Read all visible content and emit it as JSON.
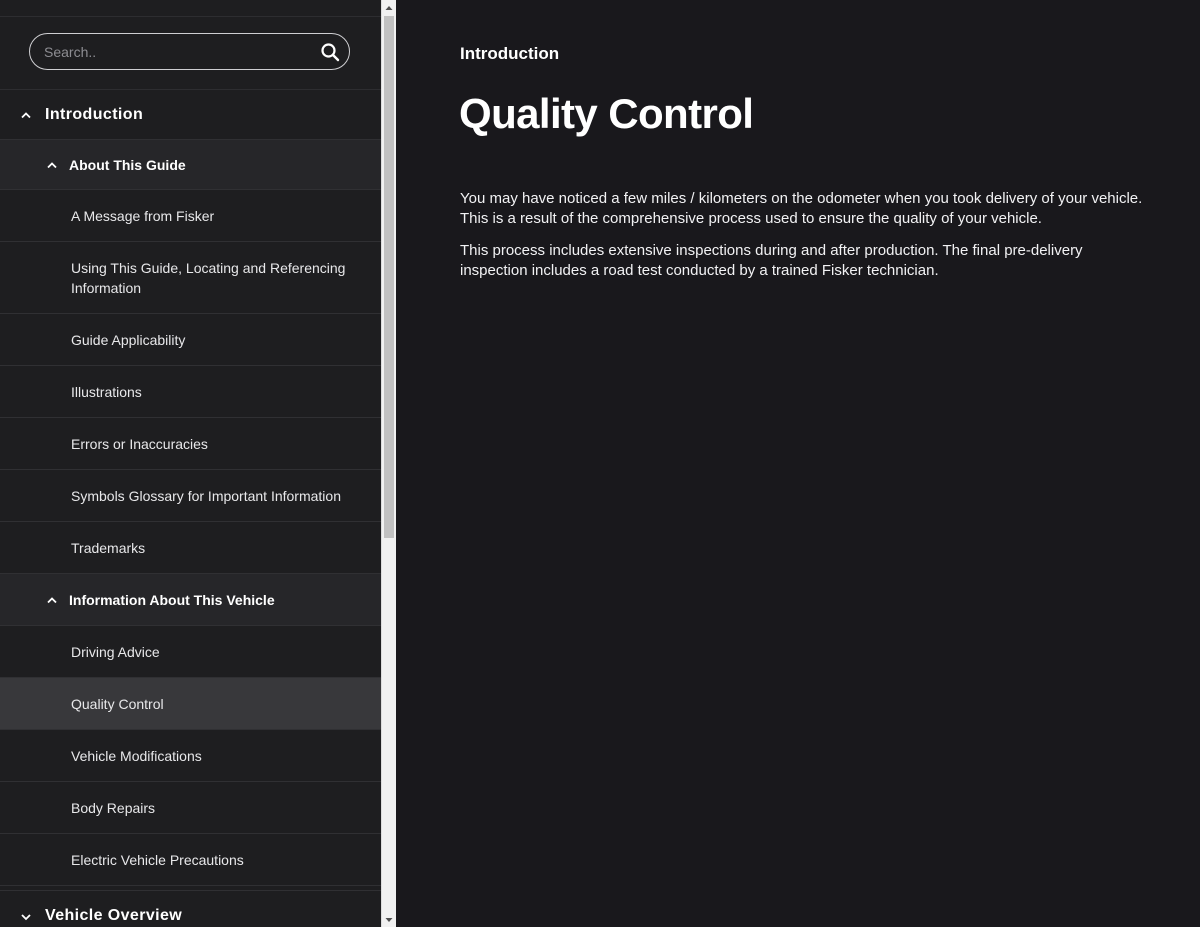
{
  "search": {
    "placeholder": "Search.."
  },
  "nav": {
    "introduction": "Introduction",
    "about_guide": "About This Guide",
    "about_items": [
      "A Message from Fisker",
      "Using This Guide, Locating and Referencing Information",
      "Guide Applicability",
      "Illustrations",
      "Errors or Inaccuracies",
      "Symbols Glossary for Important Information",
      "Trademarks"
    ],
    "info_vehicle": "Information About This Vehicle",
    "info_items": [
      "Driving Advice",
      "Quality Control",
      "Vehicle Modifications",
      "Body Repairs",
      "Electric Vehicle Precautions"
    ],
    "vehicle_overview": "Vehicle Overview",
    "active_item": "Quality Control"
  },
  "main": {
    "breadcrumb": "Introduction",
    "title": "Quality Control",
    "paragraphs": [
      "You may have noticed a few miles / kilometers on the odometer when you took delivery of your vehicle. This is a result of the comprehensive process used to ensure the quality of your vehicle.",
      "This process includes extensive inspections during and after production. The final pre-delivery inspection includes a road test conducted by a trained Fisker technician."
    ]
  },
  "icons": {
    "search": "search-icon",
    "expanded": "chevron-up-icon",
    "collapsed": "chevron-down-icon"
  },
  "colors": {
    "sidebar_bg": "#1e1e20",
    "section_bg": "#262629",
    "active_bg": "#38383b",
    "main_bg": "#19181c",
    "text": "#ffffff"
  }
}
